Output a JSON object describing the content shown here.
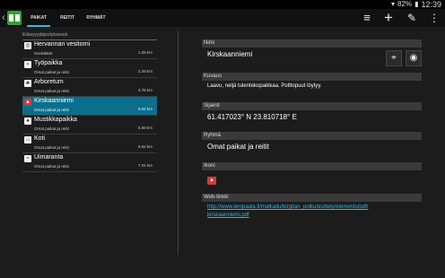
{
  "statusbar": {
    "battery": "82%",
    "time": "12:39",
    "wifi_icon": "wifi-icon",
    "battery_icon": "battery-icon"
  },
  "tabs": [
    {
      "label": "PAIKAT",
      "active": true
    },
    {
      "label": "REITIT",
      "active": false
    },
    {
      "label": "RYHMÄT",
      "active": false
    }
  ],
  "toolbar": {
    "icons": [
      "sort-icon",
      "add-icon",
      "edit-icon",
      "overflow-menu-icon"
    ]
  },
  "list": {
    "header": "Etäisyysjärjestyksessä",
    "items": [
      {
        "name": "Hervannan vesitorni",
        "sub": "Geokätköt",
        "distance": "1.28 km",
        "icon": "target-icon",
        "selected": false
      },
      {
        "name": "Työpaikka",
        "sub": "Omat paikat ja reitit",
        "distance": "2.29 km",
        "icon": "briefcase-icon",
        "selected": false
      },
      {
        "name": "Arboretum",
        "sub": "Omat paikat ja reitit",
        "distance": "4.76 km",
        "icon": "tree-icon",
        "selected": false
      },
      {
        "name": "Kirskaanniemi",
        "sub": "Omat paikat ja reitit",
        "distance": "5.52 km",
        "icon": "campfire-icon",
        "selected": true
      },
      {
        "name": "Mustikkapaikka",
        "sub": "Omat paikat ja reitit",
        "distance": "5.69 km",
        "icon": "berry-icon",
        "selected": false
      },
      {
        "name": "Koti",
        "sub": "Omat paikat ja reitit",
        "distance": "6.62 km",
        "icon": "home-icon",
        "selected": false
      },
      {
        "name": "Uimaranta",
        "sub": "Omat paikat ja reitit",
        "distance": "7.01 km",
        "icon": "swimmer-icon",
        "selected": false
      }
    ]
  },
  "detail": {
    "name_label": "Nimi",
    "name_value": "Kirskaanniemi",
    "description_label": "Kuvaus",
    "description_value": "Laavu, neljä tulentekopaikkaa. Polttopuut löytyy.",
    "location_label": "Sijainti",
    "location_value": "61.417023° N  23.810718° E",
    "group_label": "Ryhmä",
    "group_value": "Omat paikat ja reitit",
    "icon_label": "Ikoni",
    "weblink_label": "Web-linkki",
    "weblink_line1": "http://www.lempaala.fi/matkailu/birgitan_polku/esittely/elements/pdf/",
    "weblink_line2": "kirskaanniemi.pdf"
  },
  "colors": {
    "accent": "#33b5e5",
    "selected": "#0b6e8d",
    "app_icon": "#3a9c3a",
    "campfire_icon": "#d43a3a"
  }
}
